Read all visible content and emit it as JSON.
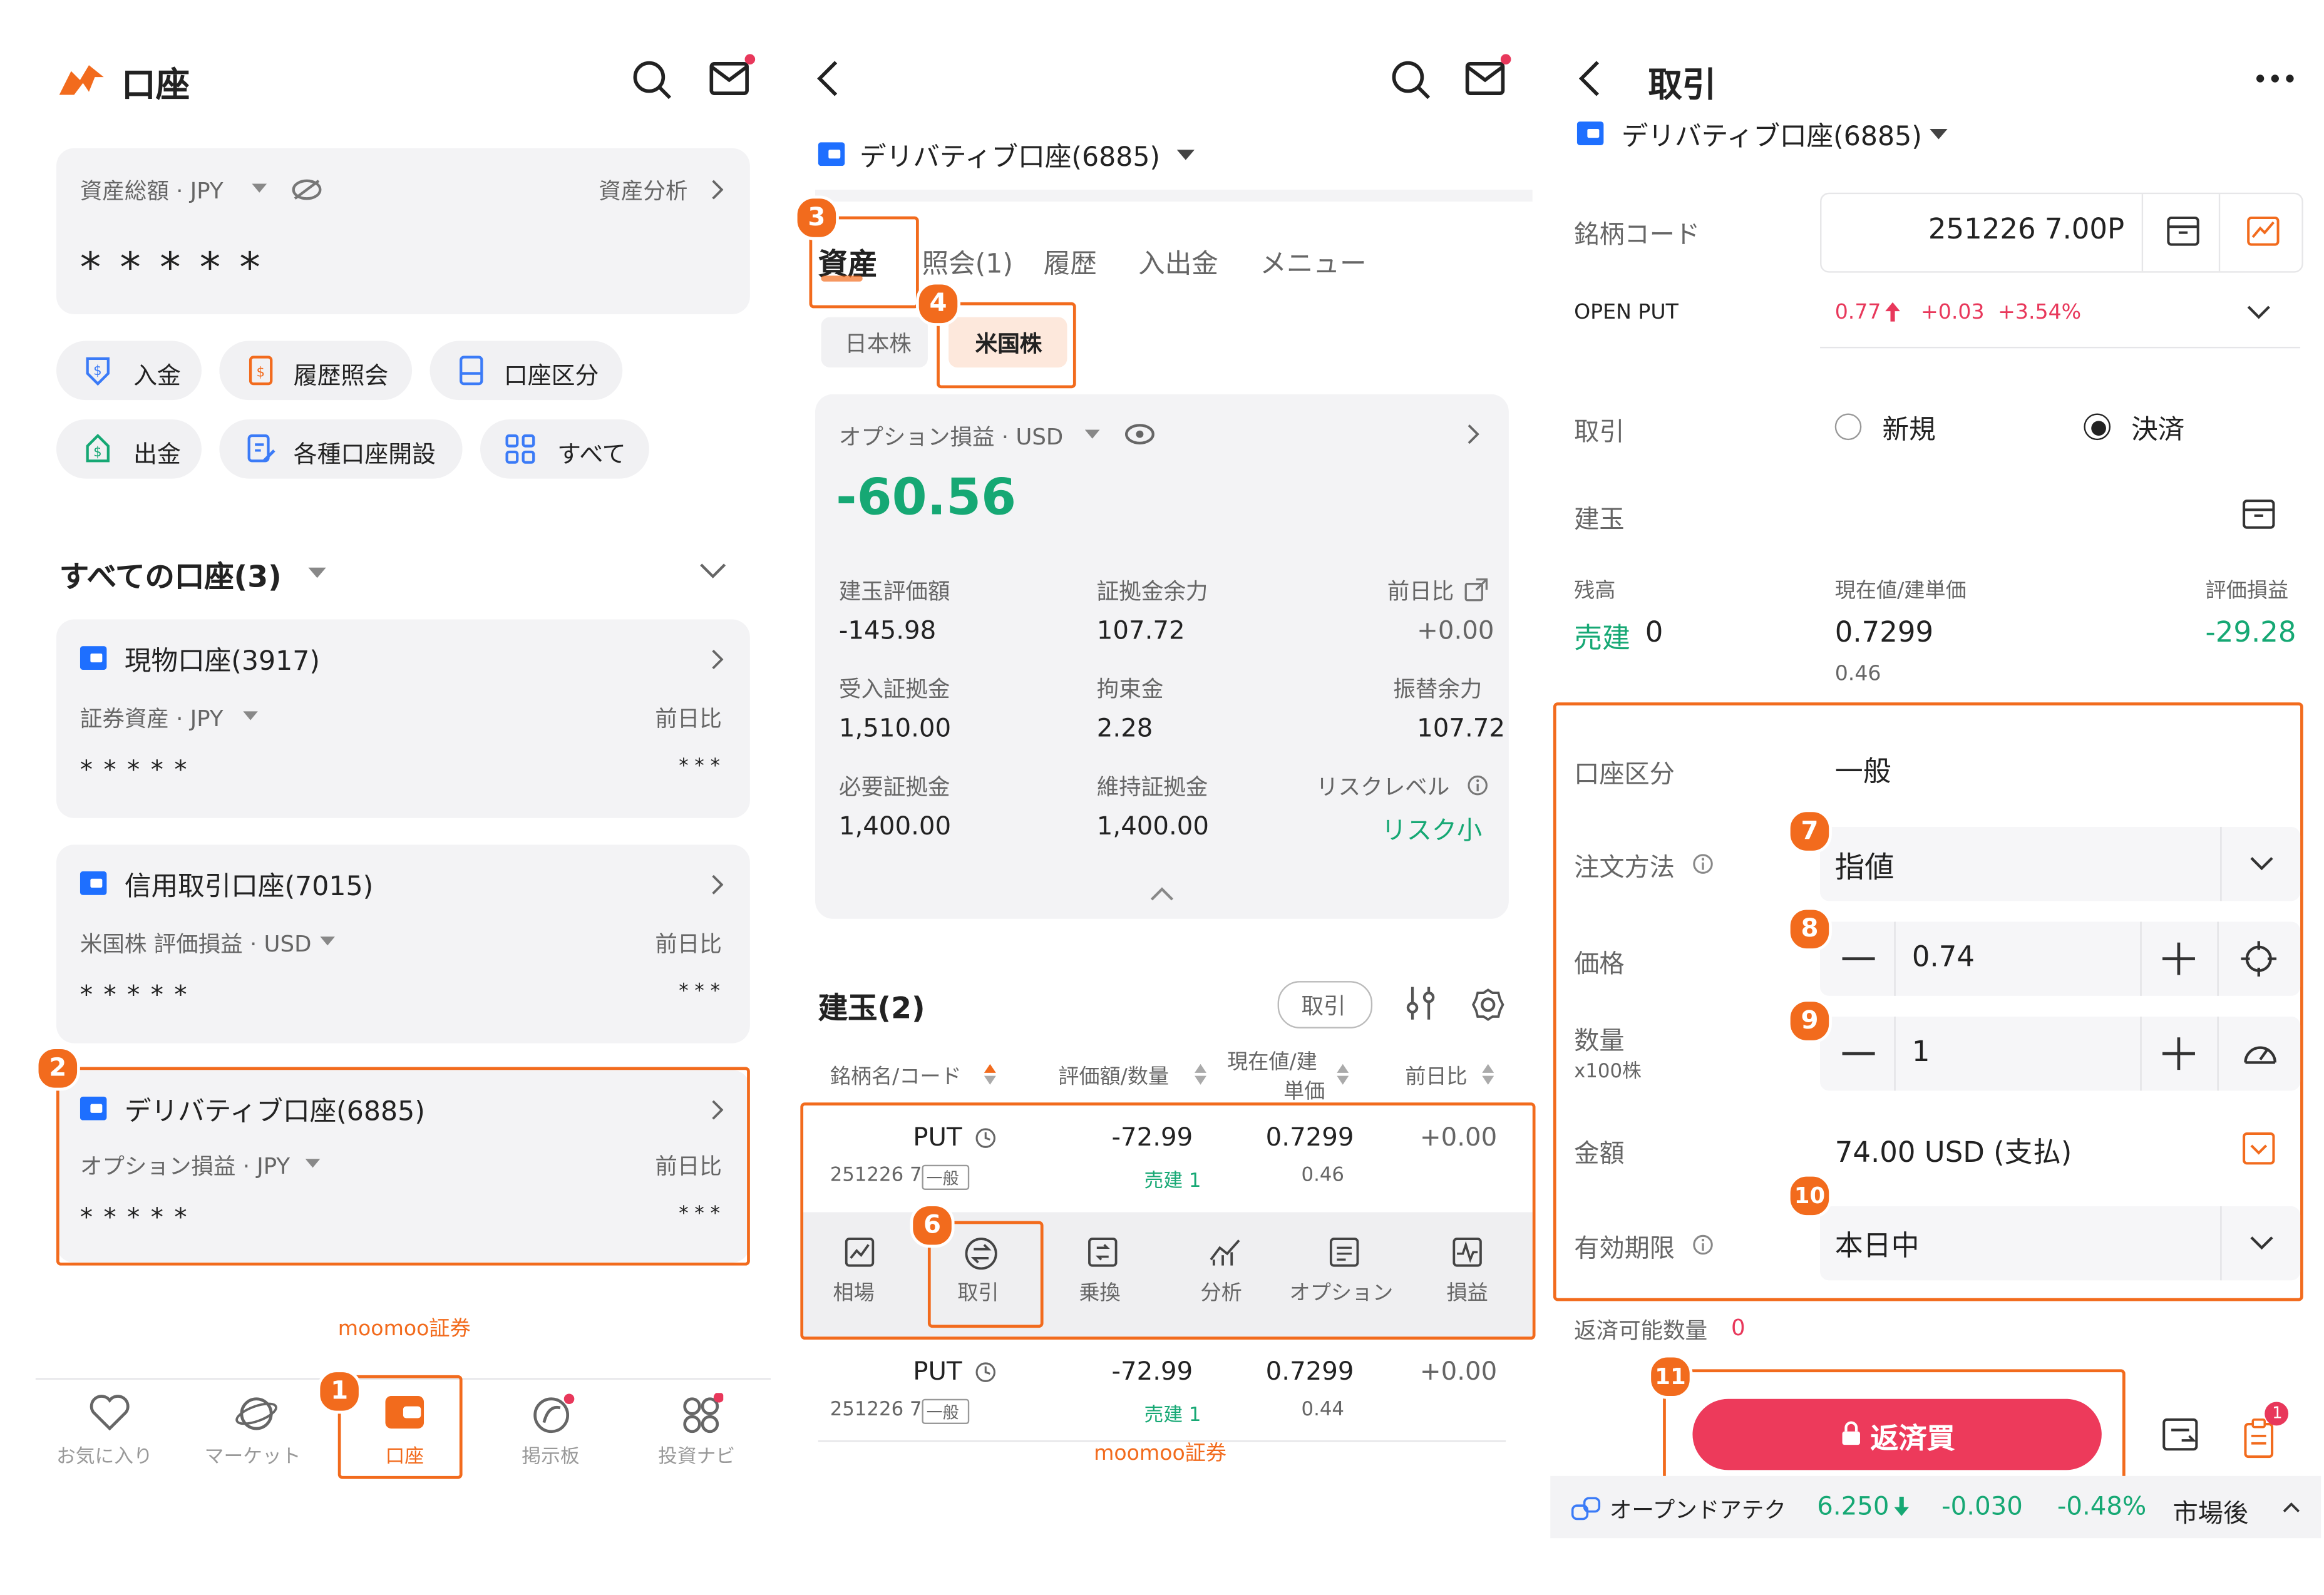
{
  "colors": {
    "accent": "#f26b1d",
    "green": "#16a874",
    "red": "#e8385b",
    "blue": "#1e6fff"
  },
  "panel1": {
    "title": "口座",
    "assets_label": "資産総額 · JPY",
    "asset_analysis": "資産分析",
    "masked": "* * * * *",
    "actions": [
      "入金",
      "履歴照会",
      "口座区分",
      "出金",
      "各種口座開設",
      "すべて"
    ],
    "all_accounts": "すべての口座(3)",
    "accounts": [
      {
        "name": "現物口座(3917)",
        "sub": "証券資産 · JPY",
        "day": "前日比",
        "mask": "* * * * *",
        "mask2": "* * *"
      },
      {
        "name": "信用取引口座(7015)",
        "sub": "米国株 評価損益 · USD",
        "day": "前日比",
        "mask": "* * * * *",
        "mask2": "* * *"
      },
      {
        "name": "デリバティブ口座(6885)",
        "sub": "オプション損益 · JPY",
        "day": "前日比",
        "mask": "* * * * *",
        "mask2": "* * *"
      }
    ],
    "footer_brand": "moomoo証券",
    "nav": [
      "お気に入り",
      "マーケット",
      "口座",
      "掲示板",
      "投資ナビ"
    ]
  },
  "panel2": {
    "account": "デリバティブ口座(6885)",
    "tabs": [
      "資産",
      "照会(1)",
      "履歴",
      "入出金",
      "メニュー"
    ],
    "subtabs": [
      "日本株",
      "米国株"
    ],
    "option_pl_label": "オプション損益 · USD",
    "option_pl_value": "-60.56",
    "grid": [
      {
        "label": "建玉評価額",
        "value": "-145.98"
      },
      {
        "label": "証拠金余力",
        "value": "107.72"
      },
      {
        "label": "前日比",
        "value": "+0.00"
      },
      {
        "label": "受入証拠金",
        "value": "1,510.00"
      },
      {
        "label": "拘束金",
        "value": "2.28"
      },
      {
        "label": "振替余力",
        "value": "107.72"
      },
      {
        "label": "必要証拠金",
        "value": "1,400.00"
      },
      {
        "label": "維持証拠金",
        "value": "1,400.00"
      },
      {
        "label": "リスクレベル",
        "value": "リスク小"
      }
    ],
    "positions_title": "建玉(2)",
    "trade_button": "取引",
    "columns": [
      "銘柄名/コード",
      "評価額/数量",
      "現在値/建",
      "単価",
      "前日比"
    ],
    "rows": [
      {
        "name": "PUT",
        "code": "251226 7",
        "tag": "一般",
        "value": "-72.99",
        "qty": "売建 1",
        "price": "0.7299",
        "cost": "0.46",
        "change": "+0.00"
      },
      {
        "name": "PUT",
        "code": "251226 7",
        "tag": "一般",
        "value": "-72.99",
        "qty": "売建 1",
        "price": "0.7299",
        "cost": "0.44",
        "change": "+0.00"
      }
    ],
    "row_actions": [
      "相場",
      "取引",
      "乗換",
      "分析",
      "オプション",
      "損益"
    ],
    "footer_brand": "moomoo証券"
  },
  "panel3": {
    "title": "取引",
    "account": "デリバティブ口座(6885)",
    "code_label": "銘柄コード",
    "code_value": "251226 7.00P",
    "open_put": "OPEN PUT",
    "quote": {
      "price": "0.77",
      "change": "+0.03",
      "pct": "+3.54%"
    },
    "trade_label": "取引",
    "trade_options": [
      "新規",
      "決済"
    ],
    "position_label": "建玉",
    "stats": [
      {
        "label": "残高",
        "value": "0",
        "prefix": "売建"
      },
      {
        "label": "現在値/建単価",
        "value": "0.7299",
        "sub": "0.46"
      },
      {
        "label": "評価損益",
        "value": "-29.28"
      }
    ],
    "account_type_label": "口座区分",
    "account_type_value": "一般",
    "order_type_label": "注文方法",
    "order_type_value": "指値",
    "price_label": "価格",
    "price_value": "0.74",
    "qty_label": "数量",
    "qty_unit": "x100株",
    "qty_value": "1",
    "amount_label": "金額",
    "amount_value": "74.00 USD (支払)",
    "expiry_label": "有効期限",
    "expiry_value": "本日中",
    "closable_label": "返済可能数量",
    "closable_value": "0",
    "submit": "返済買",
    "notif_count": "1",
    "ticker": {
      "name": "オープンドアテク",
      "price": "6.250",
      "change": "-0.030",
      "pct": "-0.48%",
      "session": "市場後"
    }
  },
  "badges": [
    "1",
    "2",
    "3",
    "4",
    "6",
    "7",
    "8",
    "9",
    "10",
    "11"
  ]
}
